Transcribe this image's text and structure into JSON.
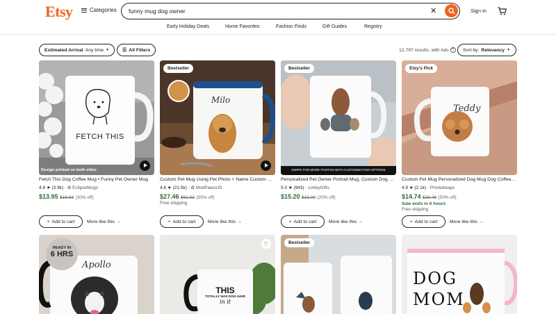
{
  "header": {
    "logo": "Etsy",
    "categories_label": "Categories",
    "search_value": "funny mug dog owner",
    "signin_label": "Sign in"
  },
  "nav": [
    "Early Holiday Deals",
    "Home Favorites",
    "Fashion Finds",
    "Gift Guides",
    "Registry"
  ],
  "filters": {
    "arrival_label": "Estimated Arrival",
    "arrival_value": "Any time",
    "all_filters": "All Filters",
    "results_text": "12,797 results, with Ads",
    "sort_label": "Sort by:",
    "sort_value": "Relevancy"
  },
  "listings": [
    {
      "badge": "",
      "overlay_text": "Design printed on both sides",
      "mug_text": "FETCH THIS",
      "title": "Fetch This Dog Coffee Mug • Funny Pet Owner Mug",
      "rating": "4.9",
      "reviews": "(3.9k)",
      "shop": "EclipseMugs",
      "price": "$13.95",
      "original_price": "$19.93",
      "discount": "(30% off)",
      "sale": "",
      "shipping": "",
      "add_to_cart": "Add to cart",
      "more_like": "More like this"
    },
    {
      "badge": "Bestseller",
      "overlay_text": "",
      "mug_text": "Milo",
      "title": "Custom Pet Mug Using Pet Photo + Name Custom Dog Mug",
      "rating": "4.8",
      "reviews": "(21.5k)",
      "shop": "ModPawsUS",
      "price": "$27.46",
      "original_price": "$61.03",
      "discount": "(55% off)",
      "sale": "",
      "shipping": "Free shipping",
      "add_to_cart": "Add to cart",
      "more_like": "More like this"
    },
    {
      "badge": "Bestseller",
      "overlay_text": "SWIPE FOR MORE PHOTOS WITH CUSTOMIZATION OPTIONS",
      "mug_text": "",
      "title": "Personalized Pet Owner Portrait Mug, Custom Dog Mom Mug",
      "rating": "5.0",
      "reviews": "(943)",
      "shop": "LinleyGifts",
      "price": "$15.20",
      "original_price": "$19.00",
      "discount": "(20% off)",
      "sale": "",
      "shipping": "",
      "add_to_cart": "Add to cart",
      "more_like": "More like this"
    },
    {
      "badge": "Etsy's Pick",
      "overlay_text": "",
      "mug_text": "Teddy",
      "title": "Custom Pet Mug Personalized Dog Mug Dog Coffee Mug",
      "rating": "4.9",
      "reviews": "(2.1k)",
      "shop": "Printedways",
      "price": "$14.74",
      "original_price": "$29.48",
      "discount": "(50% off)",
      "sale": "Sale ends in 6 hours",
      "shipping": "Free shipping",
      "add_to_cart": "Add to cart",
      "more_like": "More like this"
    }
  ],
  "row2": [
    {
      "badge": "",
      "ready_line1": "READY IN",
      "ready_line2": "6 HRS",
      "mug_text": "Apollo"
    },
    {
      "badge": "",
      "mug_line1": "THIS",
      "mug_line2": "TOTALLY HAS DOG HAIR",
      "mug_line3": "in it"
    },
    {
      "badge": "Bestseller"
    },
    {
      "badge": "",
      "mug_line1": "DOG",
      "mug_line2": "MOM"
    }
  ],
  "colors": {
    "brand": "#f1641e",
    "price_green": "#2b6b36"
  }
}
